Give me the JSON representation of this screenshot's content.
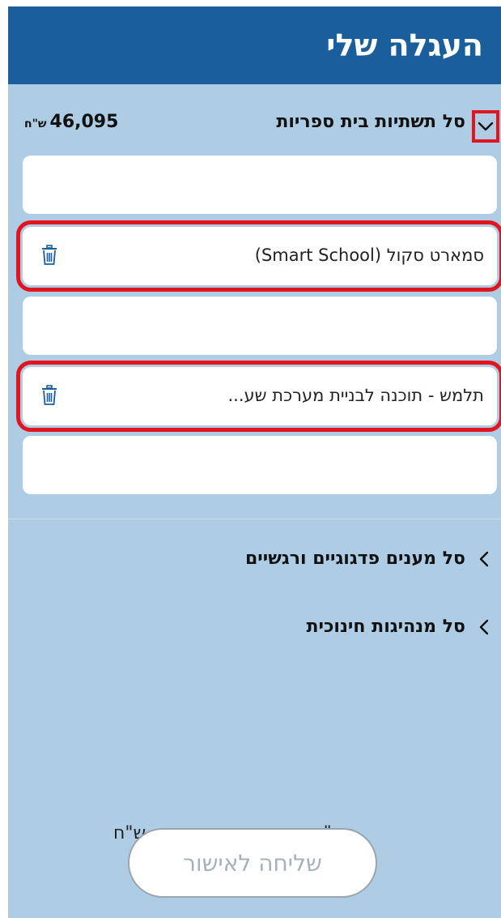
{
  "header": {
    "title": "העגלה שלי"
  },
  "basket": {
    "title": "סל תשתיות בית ספריות",
    "total": "46,095",
    "currency": "ש\"ח",
    "items": [
      {
        "label": ""
      },
      {
        "label": "סמארט סקול (Smart School)"
      },
      {
        "label": ""
      },
      {
        "label": "תלמש - תוכנה לבניית מערכת שע..."
      },
      {
        "label": ""
      }
    ]
  },
  "categories": [
    {
      "label": "סל מענים פדגוגיים ורגשיים"
    },
    {
      "label": "סל מנהיגות חינוכית"
    }
  ],
  "summary": {
    "total_label": "סה\"כ",
    "currency_label": "ש\"ח"
  },
  "submit": {
    "label": "שליחה לאישור"
  },
  "colors": {
    "header_bg": "#1b5e9c",
    "panel_bg": "#aecde4",
    "highlight": "#e3141e"
  },
  "icons": {
    "expand": "chevron-down-icon",
    "collapsed": "chevron-left-icon",
    "delete": "trash-icon"
  }
}
